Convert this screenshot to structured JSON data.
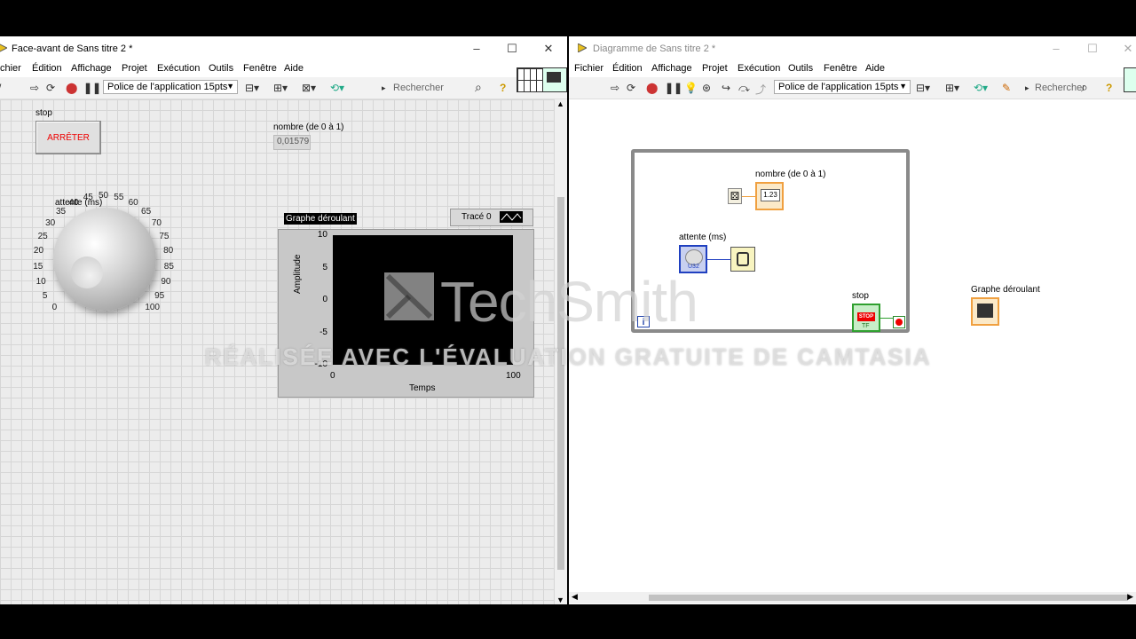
{
  "left_window": {
    "title": "Face-avant de Sans titre 2 *",
    "menu": [
      "chier",
      "Édition",
      "Affichage",
      "Projet",
      "Exécution",
      "Outils",
      "Fenêtre",
      "Aide"
    ],
    "font_select": "Police de l'application 15pts",
    "search_placeholder": "Rechercher",
    "controls": {
      "stop_label": "stop",
      "stop_button_text": "ARRÊTER",
      "number_label": "nombre (de 0 à 1)",
      "number_value": "0,01579",
      "knob_label": "attente (ms)",
      "knob_ticks": [
        "0",
        "5",
        "10",
        "15",
        "20",
        "25",
        "30",
        "35",
        "40",
        "45",
        "50",
        "55",
        "60",
        "65",
        "70",
        "75",
        "80",
        "85",
        "90",
        "95",
        "100"
      ]
    },
    "chart": {
      "title": "Graphe déroulant",
      "legend_label": "Tracé 0",
      "ylabel": "Amplitude",
      "xlabel": "Temps",
      "y_ticks": [
        "10",
        "5",
        "0",
        "-5",
        "-10"
      ],
      "x_ticks": [
        "0",
        "100"
      ],
      "chart_data": {
        "type": "line",
        "title": "Graphe déroulant",
        "xlabel": "Temps",
        "ylabel": "Amplitude",
        "xlim": [
          0,
          100
        ],
        "ylim": [
          -10,
          10
        ],
        "series": [
          {
            "name": "Tracé 0",
            "values": []
          }
        ]
      }
    }
  },
  "right_window": {
    "title": "Diagramme de Sans titre 2 *",
    "menu": [
      "Fichier",
      "Édition",
      "Affichage",
      "Projet",
      "Exécution",
      "Outils",
      "Fenêtre",
      "Aide"
    ],
    "font_select": "Police de l'application 15pts",
    "search_placeholder": "Rechercher",
    "nodes": {
      "number_label": "nombre (de 0 à 1)",
      "number_terminal": "1.23",
      "wait_label": "attente (ms)",
      "wait_terminal": "U32",
      "stop_label": "stop",
      "stop_terminal": "STOP",
      "stop_tf": "TF",
      "graph_label": "Graphe déroulant",
      "iteration": "i"
    }
  },
  "watermark": {
    "brand": "TechSmith",
    "text": "RÉALISÉE AVEC L'ÉVALUATION GRATUITE DE CAMTASIA"
  },
  "colors": {
    "stop_text": "#e00000",
    "loop_border": "#8a8a8a",
    "wire_orange": "#f0a040",
    "wire_blue": "#2040c0",
    "wire_green": "#30a030"
  }
}
